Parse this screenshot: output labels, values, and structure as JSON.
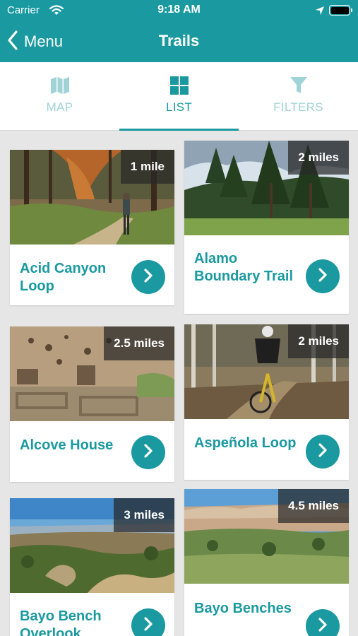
{
  "status_bar": {
    "carrier": "Carrier",
    "time": "9:18 AM",
    "icons": [
      "wifi-icon",
      "location-arrow-icon",
      "battery-icon"
    ]
  },
  "nav": {
    "back_label": "Menu",
    "title": "Trails"
  },
  "tabs": [
    {
      "label": "MAP",
      "icon": "map-icon",
      "active": false
    },
    {
      "label": "LIST",
      "icon": "grid-icon",
      "active": true
    },
    {
      "label": "FILTERS",
      "icon": "filter-icon",
      "active": false
    }
  ],
  "trails": [
    {
      "name": "Acid Canyon Loop",
      "distance": "1 mile"
    },
    {
      "name": "Alamo Boundary Trail",
      "distance": "2 miles"
    },
    {
      "name": "Alcove House",
      "distance": "2.5 miles"
    },
    {
      "name": "Aspeñola Loop",
      "distance": "2 miles"
    },
    {
      "name": "Bayo Bench Overlook",
      "distance": "3 miles"
    },
    {
      "name": "Bayo Benches",
      "distance": "4.5 miles"
    }
  ],
  "colors": {
    "accent": "#1a9aa0",
    "accent_muted": "#9fd3d6",
    "background": "#e6e6e6",
    "badge": "#282828"
  }
}
